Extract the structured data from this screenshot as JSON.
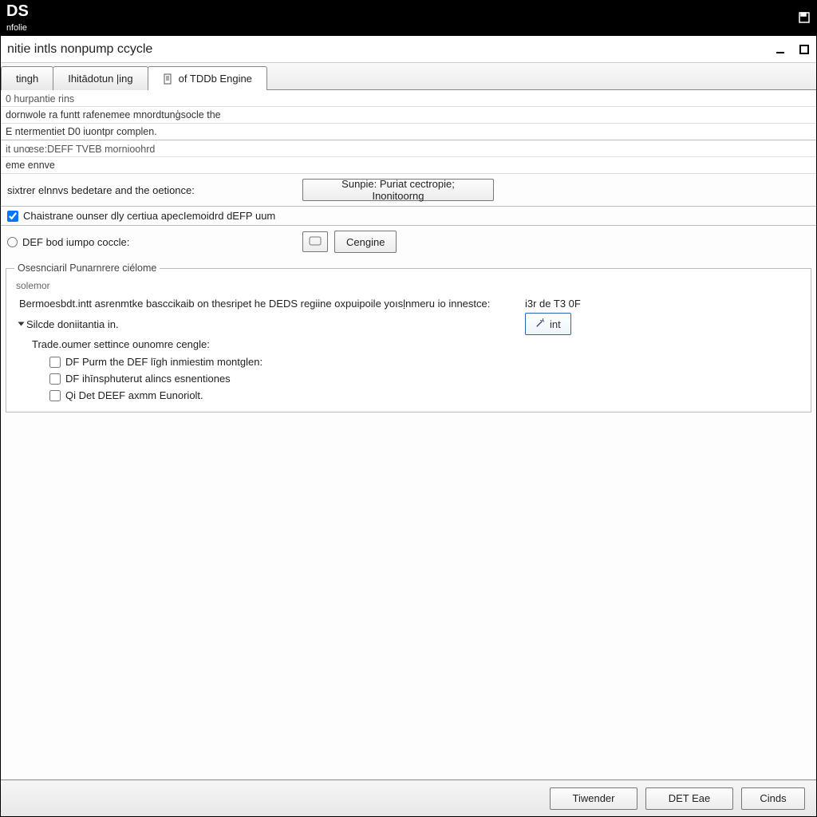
{
  "app": {
    "brand": "DS",
    "brand_sub": "nfolie"
  },
  "window": {
    "title": "nitie intls nonpump ccycle"
  },
  "tabs": [
    {
      "label": "tingh"
    },
    {
      "label": "Ihitādotun |ing"
    },
    {
      "label": "of TDDb Engine"
    }
  ],
  "sections": {
    "s1_head": "0 hurpantie rins",
    "s1_line1": "dornwole ra funtt rafenemee mnordtunģsocle the",
    "s1_line2": "E ntermentiet D0 iuontpr complen.",
    "s2_head": "it unœse:DEFF TVEB mornioohrd",
    "s2_sub": "eme ennve",
    "s2_row_label": "sixtrer elnnvs bedetare and the oetionce:",
    "s2_button": "Sunpie:   Puriat cectropie; Inonitoorng",
    "s2_check": "Chaistrane ounser dly certiua apecIemoidrd dEFP uum",
    "s2_radio": "DEF bod iumpo coccle:",
    "s2_engine_btn": "Cengine",
    "s3_head": "Osesnciaril Punarnrere ciélome",
    "s3_sub": "solemor",
    "s3_text": "Bermoesbdt.intt asrenmtke basccikaib on thesripet he DEDS regiine oxpuipoile yoısḷnmeru io innestce:",
    "s3_readout": "i3r de T3 0F",
    "s3_disclosure": "Silcde doniitantia in.",
    "s3_int_btn": "int",
    "s3_trace_head": "Trade.oumer settince ounomre cengle:",
    "s3_opt1": "DF Purm the DEF līgh inmiestim montglen:",
    "s3_opt2": "DF ihīnsphuterut alincs esnentiones",
    "s3_opt3": "Qi  Det DEEF axmm Eunoriolt."
  },
  "footer": {
    "b1": "Tiwender",
    "b2": "DET Eae",
    "b3": "Cinds"
  }
}
